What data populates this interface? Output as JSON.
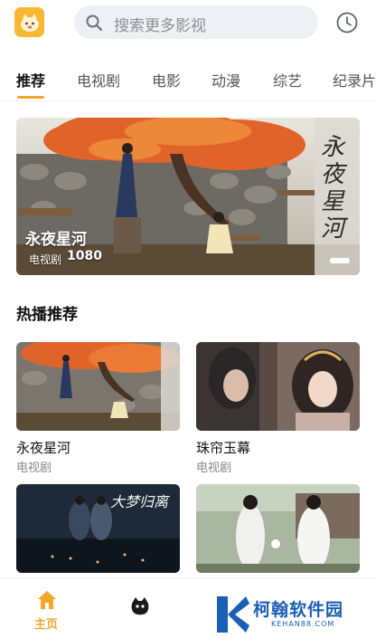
{
  "header": {
    "logo_icon": "app-logo-icon",
    "search_placeholder": "搜索更多影视",
    "history_icon": "clock-icon"
  },
  "tabs": [
    "推荐",
    "电视剧",
    "电影",
    "动漫",
    "综艺",
    "纪录片"
  ],
  "banner": {
    "title": "永夜星河",
    "category": "电视剧",
    "quality": "1080",
    "calligraphy": "永夜星河"
  },
  "section": {
    "title": "热播推荐"
  },
  "cards": [
    {
      "title": "永夜星河",
      "subtitle": "电视剧"
    },
    {
      "title": "珠帘玉幕",
      "subtitle": "电视剧"
    },
    {
      "title": "",
      "subtitle": ""
    },
    {
      "title": "",
      "subtitle": ""
    }
  ],
  "card3_overlay": "大梦归离",
  "bottom_nav": {
    "home_label": "主页",
    "home_icon": "home-icon",
    "mascot_icon": "mascot-icon"
  },
  "watermark": {
    "text": "柯翰软件园",
    "sub": "KEHAN88.COM"
  },
  "colors": {
    "accent": "#f4a52c",
    "watermark": "#1a5fb4"
  }
}
